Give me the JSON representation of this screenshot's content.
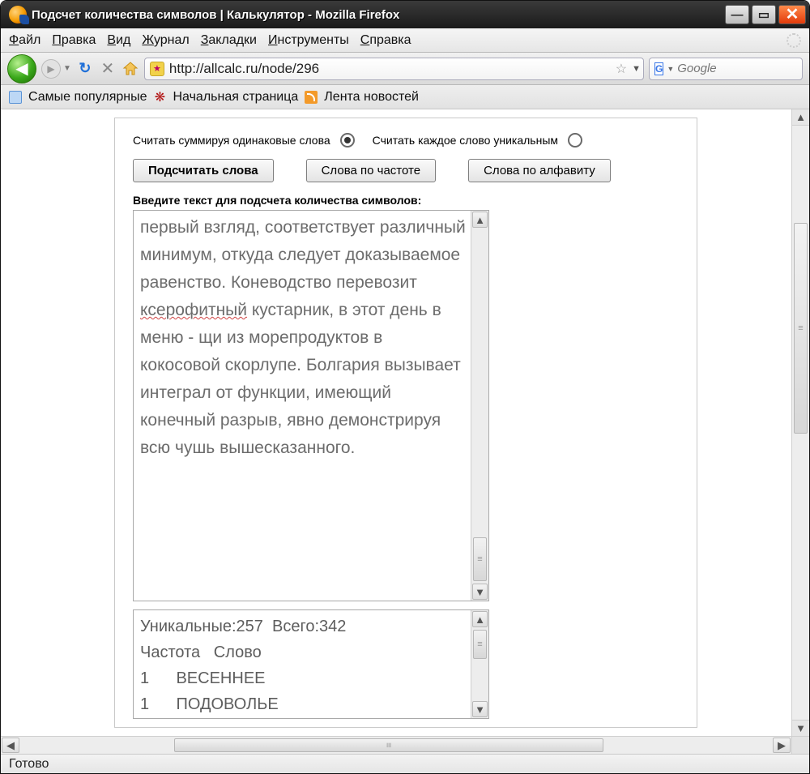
{
  "window": {
    "title": "Подсчет количества символов | Калькулятор - Mozilla Firefox"
  },
  "menu": {
    "file": "Файл",
    "edit": "Правка",
    "view": "Вид",
    "history": "Журнал",
    "bookmarks": "Закладки",
    "tools": "Инструменты",
    "help": "Справка"
  },
  "nav": {
    "url": "http://allcalc.ru/node/296",
    "search_placeholder": "Google"
  },
  "bookmarks": {
    "popular": "Самые популярные",
    "start": "Начальная страница",
    "news": "Лента новостей"
  },
  "page": {
    "radio1": "Считать суммируя одинаковые слова",
    "radio2": "Считать каждое слово уникальным",
    "btn_count": "Подсчитать слова",
    "btn_freq": "Слова по частоте",
    "btn_alpha": "Слова по алфавиту",
    "label_input": "Введите текст для подсчета количества символов:",
    "textarea_pre": "первый взгляд, соответствует различный минимум, откуда следует доказываемое равенство. Коневодство перевозит ",
    "textarea_wavy": "ксерофитный",
    "textarea_post": " кустарник, в этот день в меню - щи из морепродуктов в кокосовой скорлупе. Болгария вызывает интеграл от функции, имеющий конечный разрыв, явно демонстрируя всю чушь вышесказанного.",
    "result_summary": "Уникальные:257  Всего:342",
    "result_header_freq": "Частота",
    "result_header_word": "Слово",
    "result_rows": [
      {
        "freq": "1",
        "word": "ВЕСЕННЕЕ"
      },
      {
        "freq": "1",
        "word": "ПОДОВОЛЬЕ"
      }
    ]
  },
  "status": {
    "text": "Готово"
  }
}
